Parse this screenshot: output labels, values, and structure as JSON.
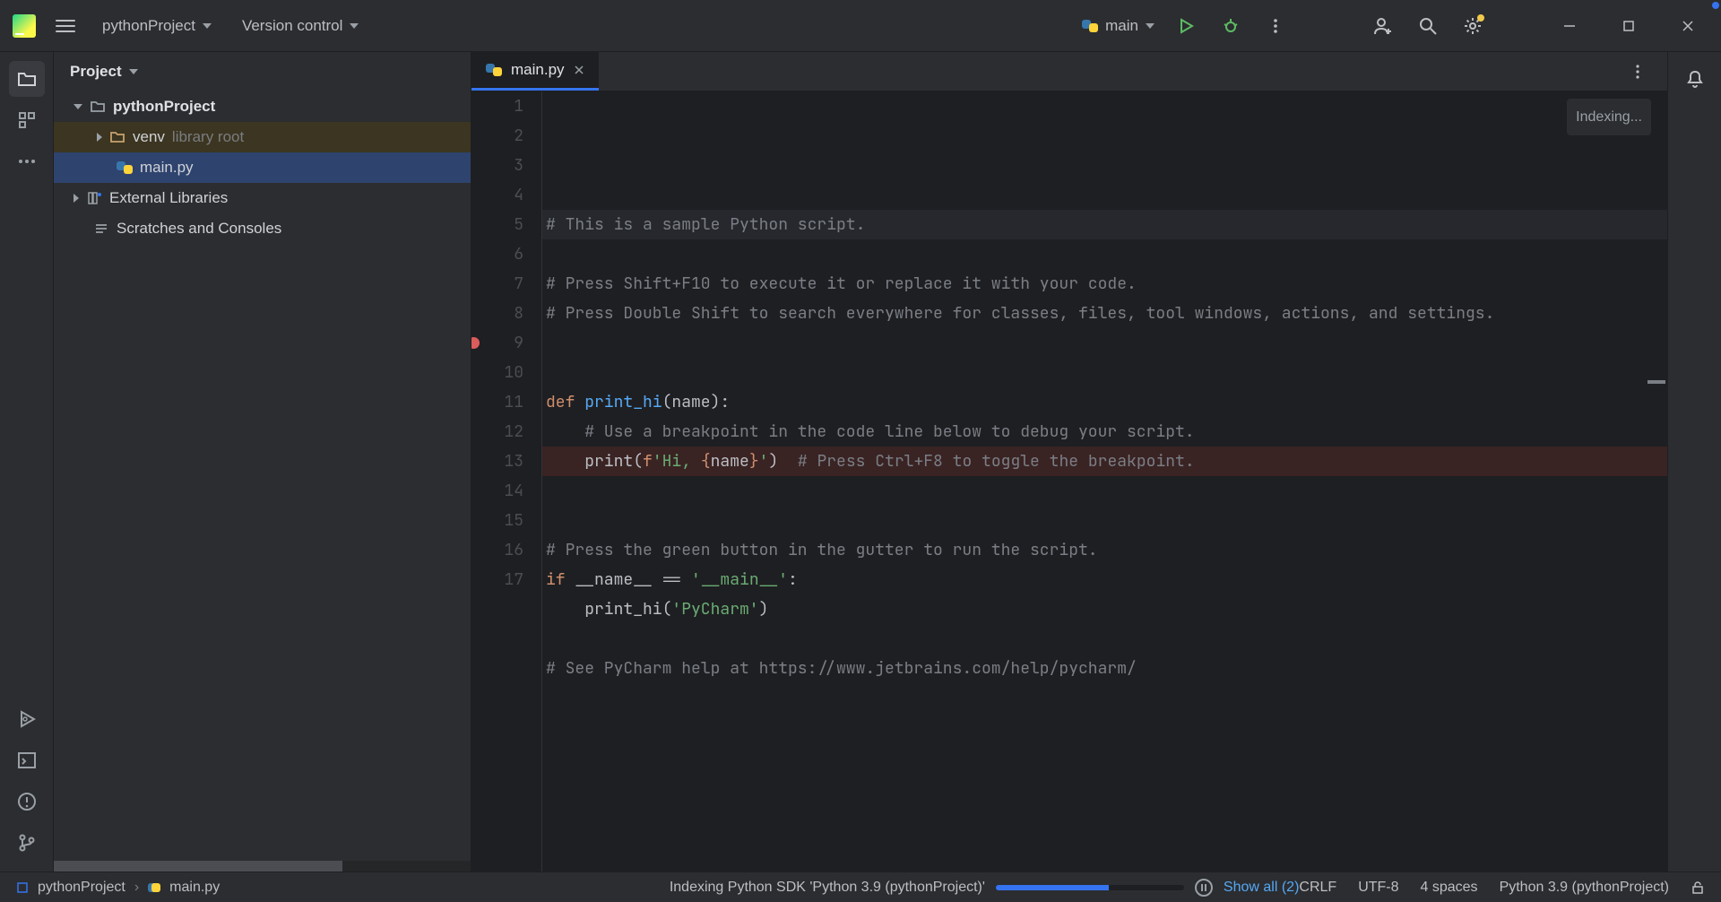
{
  "titlebar": {
    "project_dropdown": "pythonProject",
    "vcs_dropdown": "Version control",
    "run_config": "main"
  },
  "project_panel": {
    "title": "Project",
    "root": "pythonProject",
    "venv_label": "venv",
    "venv_hint": "library root",
    "main_file": "main.py",
    "external_libs": "External Libraries",
    "scratches": "Scratches and Consoles"
  },
  "tab": {
    "filename": "main.py"
  },
  "editor": {
    "indexing": "Indexing...",
    "breakpoint_line": 9,
    "lines": [
      {
        "n": 1,
        "segs": [
          {
            "cls": "c-comment",
            "t": "# This is a sample Python script."
          }
        ]
      },
      {
        "n": 2,
        "segs": []
      },
      {
        "n": 3,
        "segs": [
          {
            "cls": "c-comment",
            "t": "# Press Shift+F10 to execute it or replace it with your code."
          }
        ]
      },
      {
        "n": 4,
        "segs": [
          {
            "cls": "c-comment",
            "t": "# Press Double Shift to search everywhere for classes, files, tool windows, actions, and settings."
          }
        ]
      },
      {
        "n": 5,
        "segs": []
      },
      {
        "n": 6,
        "segs": []
      },
      {
        "n": 7,
        "segs": [
          {
            "cls": "c-keyword",
            "t": "def "
          },
          {
            "cls": "c-func",
            "t": "print_hi"
          },
          {
            "cls": "",
            "t": "(name):"
          }
        ]
      },
      {
        "n": 8,
        "segs": [
          {
            "cls": "",
            "t": "    "
          },
          {
            "cls": "c-comment",
            "t": "# Use a breakpoint in the code line below to debug your script."
          }
        ]
      },
      {
        "n": 9,
        "segs": [
          {
            "cls": "",
            "t": "    print("
          },
          {
            "cls": "c-fname",
            "t": "f"
          },
          {
            "cls": "c-string",
            "t": "'Hi, "
          },
          {
            "cls": "c-keyword",
            "t": "{"
          },
          {
            "cls": "",
            "t": "name"
          },
          {
            "cls": "c-keyword",
            "t": "}"
          },
          {
            "cls": "c-string",
            "t": "'"
          },
          {
            "cls": "",
            "t": ")  "
          },
          {
            "cls": "c-comment",
            "t": "# Press Ctrl+F8 to toggle the breakpoint."
          }
        ]
      },
      {
        "n": 10,
        "segs": []
      },
      {
        "n": 11,
        "segs": []
      },
      {
        "n": 12,
        "segs": [
          {
            "cls": "c-comment",
            "t": "# Press the green button in the gutter to run the script."
          }
        ]
      },
      {
        "n": 13,
        "segs": [
          {
            "cls": "c-keyword",
            "t": "if "
          },
          {
            "cls": "",
            "t": "__name__ == "
          },
          {
            "cls": "c-string",
            "t": "'__main__'"
          },
          {
            "cls": "",
            "t": ":"
          }
        ]
      },
      {
        "n": 14,
        "segs": [
          {
            "cls": "",
            "t": "    print_hi("
          },
          {
            "cls": "c-string",
            "t": "'PyCharm'"
          },
          {
            "cls": "",
            "t": ")"
          }
        ]
      },
      {
        "n": 15,
        "segs": []
      },
      {
        "n": 16,
        "segs": [
          {
            "cls": "c-comment",
            "t": "# See PyCharm help at https://www.jetbrains.com/help/pycharm/"
          }
        ]
      },
      {
        "n": 17,
        "segs": []
      }
    ]
  },
  "statusbar": {
    "breadcrumb_project": "pythonProject",
    "breadcrumb_file": "main.py",
    "indexing_text": "Indexing Python SDK 'Python 3.9 (pythonProject)'",
    "show_all": "Show all (2)",
    "line_sep": "CRLF",
    "encoding": "UTF-8",
    "indent": "4 spaces",
    "interpreter": "Python 3.9 (pythonProject)"
  }
}
